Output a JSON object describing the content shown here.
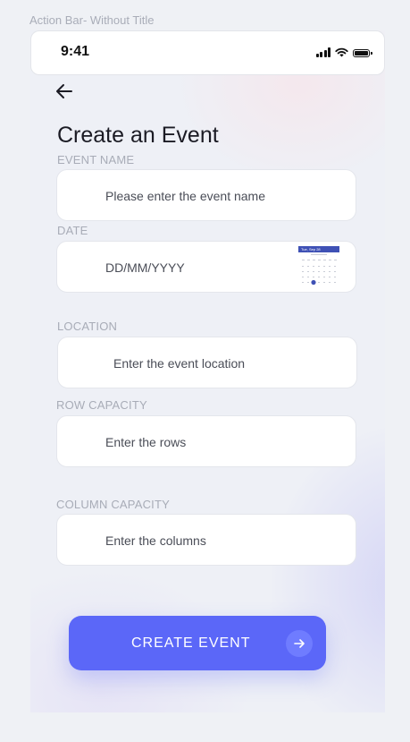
{
  "frame_label": "Action Bar- Without Title",
  "status_bar": {
    "time": "9:41",
    "icons": [
      "signal-icon",
      "wifi-icon",
      "battery-icon"
    ]
  },
  "nav": {
    "back_icon": "arrow-left-icon"
  },
  "page": {
    "title": "Create an Event"
  },
  "form": {
    "event_name": {
      "label": "EVENT NAME",
      "placeholder": "Please enter the event name"
    },
    "date": {
      "label": "DATE",
      "placeholder": "DD/MM/YYYY",
      "calendar_header": "Tue, Sep 28",
      "icon": "calendar-icon"
    },
    "location": {
      "label": "LOCATION",
      "placeholder": "Enter the event location"
    },
    "row_capacity": {
      "label": "ROW CAPACITY",
      "placeholder": "Enter the rows"
    },
    "column_capacity": {
      "label": "COLUMN CAPACITY",
      "placeholder": "Enter the columns"
    }
  },
  "cta": {
    "label": "CREATE EVENT",
    "icon": "arrow-right-icon"
  },
  "colors": {
    "accent": "#5b67f8",
    "background": "#eff1f5",
    "field_bg": "#ffffff",
    "label": "#a8acb7"
  }
}
